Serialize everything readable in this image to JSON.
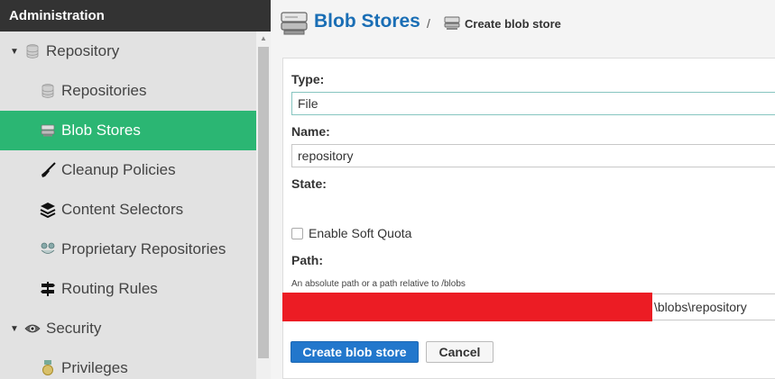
{
  "sidebar": {
    "header": "Administration",
    "items": [
      {
        "label": "Repository",
        "icon": "database-icon"
      },
      {
        "label": "Repositories",
        "icon": "database-icon"
      },
      {
        "label": "Blob Stores",
        "icon": "server-icon"
      },
      {
        "label": "Cleanup Policies",
        "icon": "broom-icon"
      },
      {
        "label": "Content Selectors",
        "icon": "layers-icon"
      },
      {
        "label": "Proprietary Repositories",
        "icon": "repo-icon"
      },
      {
        "label": "Routing Rules",
        "icon": "signpost-icon"
      },
      {
        "label": "Security",
        "icon": "eye-icon"
      },
      {
        "label": "Privileges",
        "icon": "medal-icon"
      }
    ]
  },
  "breadcrumb": {
    "title": "Blob Stores",
    "separator": "/",
    "current": "Create blob store"
  },
  "form": {
    "type_label": "Type:",
    "type_value": "File",
    "name_label": "Name:",
    "name_value": "repository",
    "state_label": "State:",
    "soft_quota_label": "Enable Soft Quota",
    "path_label": "Path:",
    "path_help": "An absolute path or a path relative to /blobs",
    "path_value": "\\blobs\\repository",
    "submit_label": "Create blob store",
    "cancel_label": "Cancel"
  },
  "colors": {
    "active_nav": "#2bb673",
    "primary_button": "#2277cc",
    "title_blue": "#1a6eb5",
    "header_bg": "#333333"
  }
}
